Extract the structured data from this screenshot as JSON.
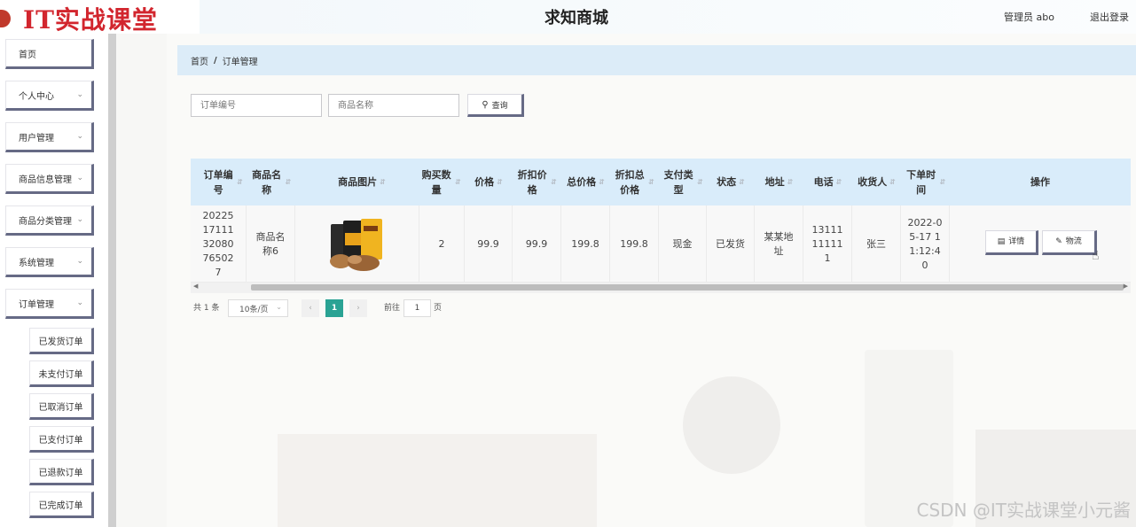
{
  "header": {
    "logo_text": "IT实战课堂",
    "title": "求知商城",
    "user": "管理员 abo",
    "logout": "退出登录"
  },
  "sidebar": {
    "items": [
      {
        "label": "首页",
        "expandable": false
      },
      {
        "label": "个人中心",
        "expandable": true
      },
      {
        "label": "用户管理",
        "expandable": true
      },
      {
        "label": "商品信息管理",
        "expandable": true
      },
      {
        "label": "商品分类管理",
        "expandable": true
      },
      {
        "label": "系统管理",
        "expandable": true
      },
      {
        "label": "订单管理",
        "expandable": true
      }
    ],
    "sub_items": [
      "已发货订单",
      "未支付订单",
      "已取消订单",
      "已支付订单",
      "已退款订单",
      "已完成订单"
    ]
  },
  "breadcrumb": {
    "home": "首页",
    "separator": "/",
    "current": "订单管理"
  },
  "search": {
    "order_no_placeholder": "订单编号",
    "product_name_placeholder": "商品名称",
    "query_label": "查询"
  },
  "table": {
    "headers": [
      "订单编号",
      "商品名称",
      "商品图片",
      "购买数量",
      "价格",
      "折扣价格",
      "总价格",
      "折扣总价格",
      "支付类型",
      "状态",
      "地址",
      "电话",
      "收货人",
      "下单时间",
      "操作"
    ],
    "rows": [
      {
        "order_no": "202251711132080765027",
        "product_name": "商品名称6",
        "quantity": "2",
        "price": "99.9",
        "discount_price": "99.9",
        "total_price": "199.8",
        "discount_total": "199.8",
        "pay_type": "现金",
        "status": "已发货",
        "address": "某某地址",
        "phone": "13111111111",
        "receiver": "张三",
        "order_time": "2022-05-17 11:12:40"
      }
    ],
    "actions": {
      "detail": "详情",
      "logistics": "物流"
    }
  },
  "pagination": {
    "total": "共 1 条",
    "page_size": "10条/页",
    "current_page": "1",
    "goto_label": "前往",
    "goto_value": "1",
    "page_unit": "页"
  },
  "watermark": "CSDN @IT实战课堂小元酱",
  "colors": {
    "accent": "#2aa394",
    "header_bg": "#d9ecfa",
    "button_shadow": "#666a85",
    "logo": "#d2262e"
  }
}
